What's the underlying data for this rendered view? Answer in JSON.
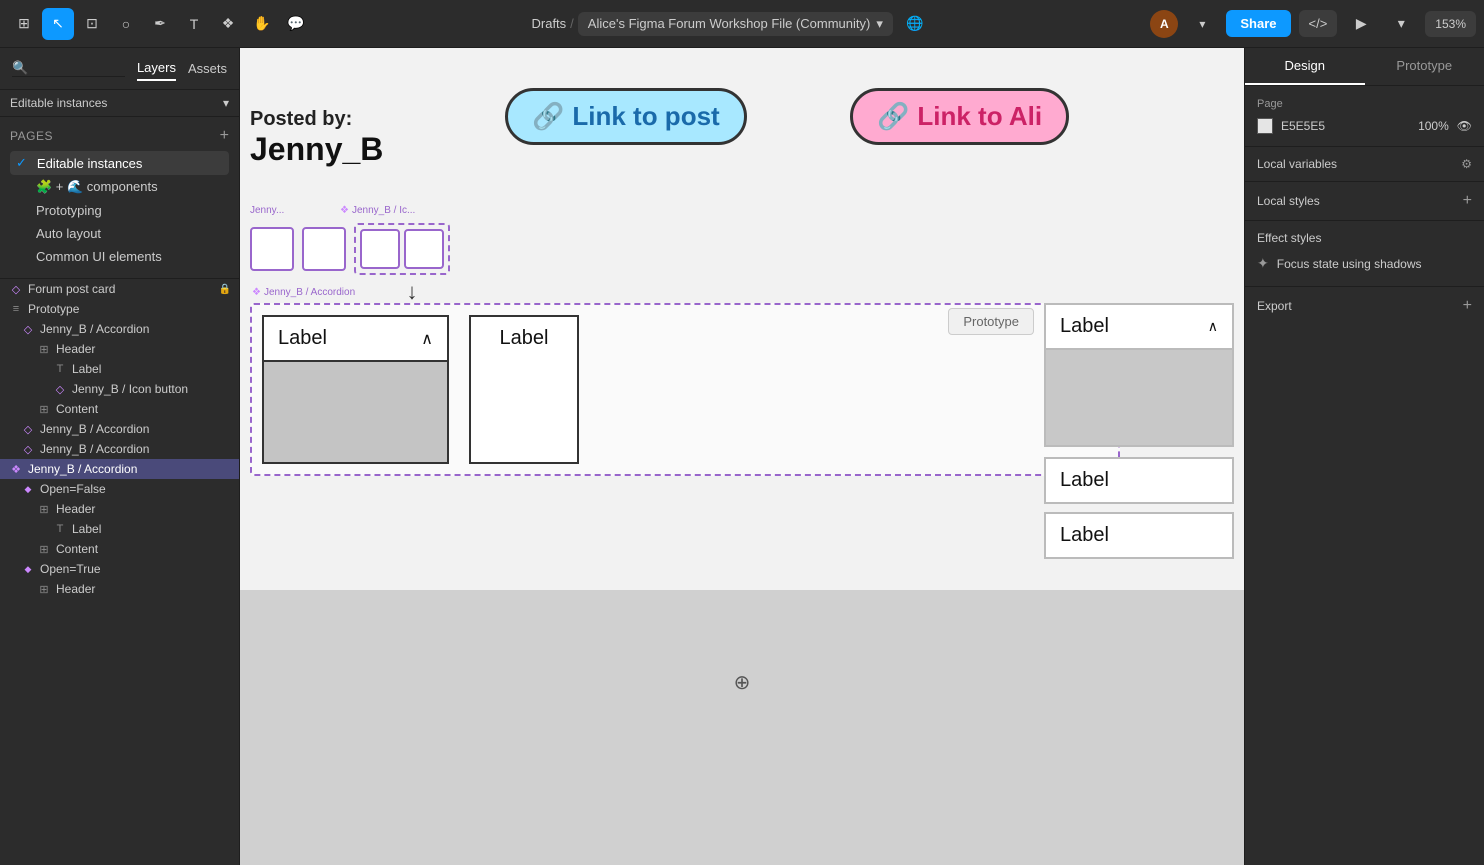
{
  "toolbar": {
    "breadcrumb_drafts": "Drafts",
    "breadcrumb_separator": "/",
    "breadcrumb_main": "Alice's Figma Forum Workshop File (Community)",
    "breadcrumb_chevron": "▾",
    "share_label": "Share",
    "code_label": "</>",
    "zoom_label": "153%"
  },
  "left_panel": {
    "tab_layers": "Layers",
    "tab_assets": "Assets",
    "editable_instances_label": "Editable instances",
    "editable_instances_chevron": "▾",
    "pages_title": "Pages",
    "pages_add": "+",
    "pages": [
      {
        "label": "Editable instances",
        "active": true
      },
      {
        "label": "🧩 + 🌊 components"
      },
      {
        "label": "Prototyping"
      },
      {
        "label": "Auto layout"
      },
      {
        "label": "Common UI elements"
      }
    ],
    "layers": [
      {
        "label": "Forum post card",
        "icon": "diamond",
        "indent": 0,
        "locked": true
      },
      {
        "label": "Prototype",
        "icon": "list",
        "indent": 0
      },
      {
        "label": "Jenny_B / Accordion",
        "icon": "diamond",
        "indent": 1
      },
      {
        "label": "Header",
        "icon": "frame",
        "indent": 2
      },
      {
        "label": "Label",
        "icon": "text",
        "indent": 3
      },
      {
        "label": "Jenny_B / Icon button",
        "icon": "diamond",
        "indent": 3
      },
      {
        "label": "Content",
        "icon": "frame",
        "indent": 2
      },
      {
        "label": "Jenny_B / Accordion",
        "icon": "diamond",
        "indent": 1
      },
      {
        "label": "Jenny_B / Accordion",
        "icon": "diamond",
        "indent": 1
      },
      {
        "label": "Jenny_B / Accordion",
        "icon": "component",
        "indent": 0,
        "active": true
      },
      {
        "label": "Open=False",
        "icon": "diamond-sm",
        "indent": 1
      },
      {
        "label": "Header",
        "icon": "frame",
        "indent": 2
      },
      {
        "label": "Label",
        "icon": "text",
        "indent": 3
      },
      {
        "label": "Content",
        "icon": "frame",
        "indent": 2
      },
      {
        "label": "Open=True",
        "icon": "diamond-sm",
        "indent": 1
      },
      {
        "label": "Header",
        "icon": "frame",
        "indent": 2
      }
    ]
  },
  "canvas": {
    "posted_by_label": "Posted by:",
    "posted_by_name": "Jenny_B",
    "link_post_text": "Link to post",
    "link_alice_text": "Link to Ali",
    "link_icon": "🔗",
    "jenny_label_top": "Jenny...",
    "jenny_b_ic_label": "Jenny_B / Ic...",
    "jenny_b_accordion_label": "Jenny_B / Accordion",
    "accordion_label": "Label",
    "down_arrow": "↓",
    "prototype_label": "Prototype",
    "label_text": "Label",
    "chevron_up": "∧",
    "icon_buttons": [
      {
        "symbol": "∨"
      },
      {
        "symbol": "→"
      },
      {
        "symbol": "∧"
      },
      {
        "symbol": "∧"
      }
    ]
  },
  "right_panel": {
    "tab_design": "Design",
    "tab_prototype": "Prototype",
    "page_section_title": "Page",
    "page_color": "E5E5E5",
    "page_opacity": "100%",
    "local_variables_label": "Local variables",
    "local_styles_label": "Local styles",
    "effect_styles_label": "Effect styles",
    "focus_state_label": "Focus state using shadows",
    "export_label": "Export",
    "add_icon": "+"
  }
}
